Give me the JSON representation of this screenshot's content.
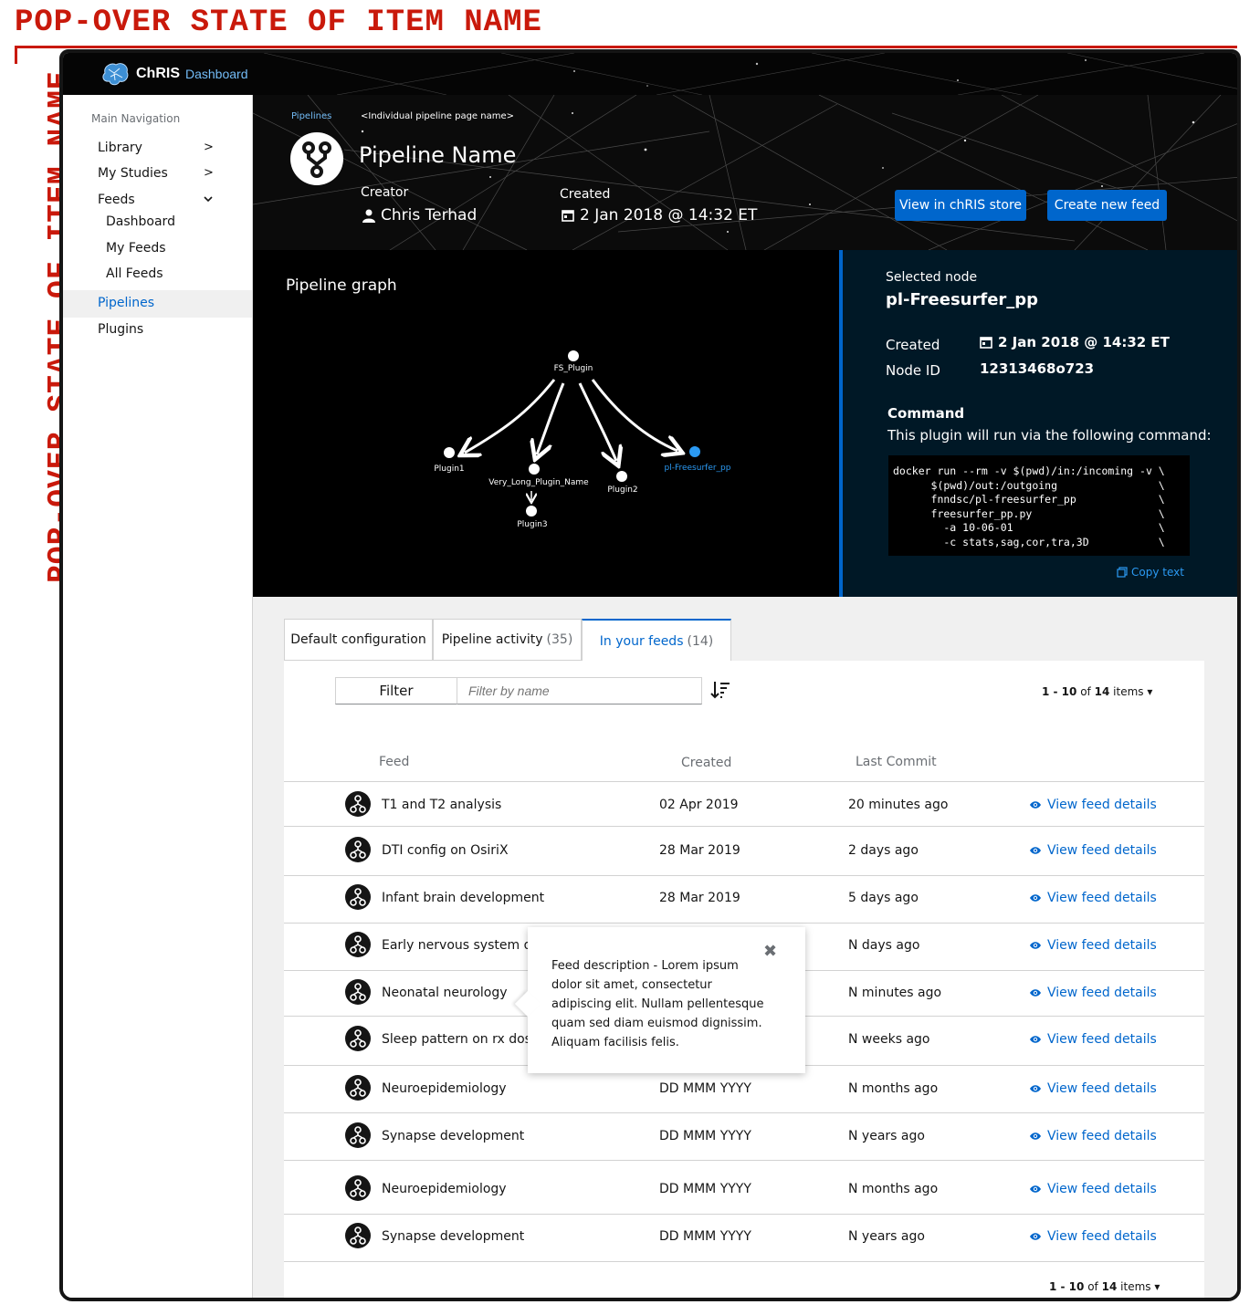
{
  "annotation": {
    "title": "POP-OVER STATE OF ITEM NAME",
    "side_title": "POP-OVER STATE OF ITEM NAME"
  },
  "masthead": {
    "brand": "ChRIS",
    "product": "Dashboard"
  },
  "sidebar": {
    "heading": "Main Navigation",
    "items": [
      {
        "label": "Library",
        "chevron": ">"
      },
      {
        "label": "My Studies",
        "chevron": ">"
      },
      {
        "label": "Feeds",
        "chevron": "v"
      },
      {
        "label": "Dashboard"
      },
      {
        "label": "My Feeds"
      },
      {
        "label": "All Feeds"
      },
      {
        "label": "Pipelines"
      },
      {
        "label": "Plugins"
      }
    ],
    "active_color": "#0066cc"
  },
  "header": {
    "breadcrumb": [
      "Pipelines",
      "<Individual pipeline page name>"
    ],
    "title": "Pipeline Name",
    "creator_label": "Creator",
    "creator_value": "Chris Terhad",
    "created_label": "Created",
    "created_value": "2 Jan 2018 @ 14:32 ET",
    "buttons": [
      "View in chRIS store",
      "Create new feed"
    ]
  },
  "graph": {
    "title": "Pipeline graph",
    "nodes": [
      {
        "label": "FS_Plugin"
      },
      {
        "label": "Plugin1"
      },
      {
        "label": "Very_Long_Plugin_Name"
      },
      {
        "label": "Plugin3"
      },
      {
        "label": "Plugin2"
      },
      {
        "label": "pl-Freesurfer_pp",
        "selected": true
      }
    ]
  },
  "node_panel": {
    "label": "Selected node",
    "name": "pl-Freesurfer_pp",
    "created_label": "Created",
    "created_value": "2 Jan 2018 @ 14:32 ET",
    "id_label": "Node ID",
    "id_value": "12313468o723",
    "command_heading": "Command",
    "command_desc": "This plugin will run via the following command:",
    "command_lines": [
      "docker run --rm -v $(pwd)/in:/incoming -v \\",
      "      $(pwd)/out:/outgoing                \\",
      "      fnndsc/pl-freesurfer_pp             \\",
      "      freesurfer_pp.py                    \\",
      "        -a 10-06-01                       \\",
      "        -c stats,sag,cor,tra,3D           \\"
    ],
    "copy_label": "Copy text"
  },
  "tabs": [
    {
      "label": "Default configuration",
      "count": ""
    },
    {
      "label": "Pipeline activity",
      "count": "(35)"
    },
    {
      "label": "In your feeds",
      "count": "(14)",
      "active": true
    }
  ],
  "toolbar": {
    "filter_label": "Filter",
    "filter_placeholder": "Filter by name",
    "pager_range": "1 - 10",
    "pager_of": "of",
    "pager_total": "14",
    "pager_items": "items"
  },
  "table": {
    "headers": [
      "Feed",
      "Created",
      "Last Commit"
    ],
    "link_label": "View feed details",
    "rows": [
      {
        "feed": "T1 and T2  analysis",
        "created": "02 Apr 2019",
        "commit": "20 minutes ago"
      },
      {
        "feed": "DTI config on OsiriX",
        "created": "28 Mar 2019",
        "commit": "2 days ago"
      },
      {
        "feed": "Infant brain development",
        "created": "28 Mar 2019",
        "commit": "5 days ago"
      },
      {
        "feed": "Early nervous system dev",
        "created": "",
        "commit": "N days ago"
      },
      {
        "feed": "Neonatal neurology",
        "created": "",
        "commit": "N minutes ago"
      },
      {
        "feed": "Sleep pattern on rx dose",
        "created": "",
        "commit": "N weeks ago"
      },
      {
        "feed": "Neuroepidemiology",
        "created": "DD MMM YYYY",
        "commit": "N months ago"
      },
      {
        "feed": "Synapse development",
        "created": "DD MMM YYYY",
        "commit": "N years ago"
      },
      {
        "feed": "Neuroepidemiology",
        "created": "DD MMM YYYY",
        "commit": "N months ago"
      },
      {
        "feed": "Synapse development",
        "created": "DD MMM YYYY",
        "commit": "N years ago"
      }
    ]
  },
  "popover": {
    "text": "Feed description - Lorem ipsum dolor sit amet, consectetur adipiscing elit. Nullam pellentesque quam sed diam euismod dignissim. Aliquam facilisis felis.",
    "close": "✖"
  }
}
